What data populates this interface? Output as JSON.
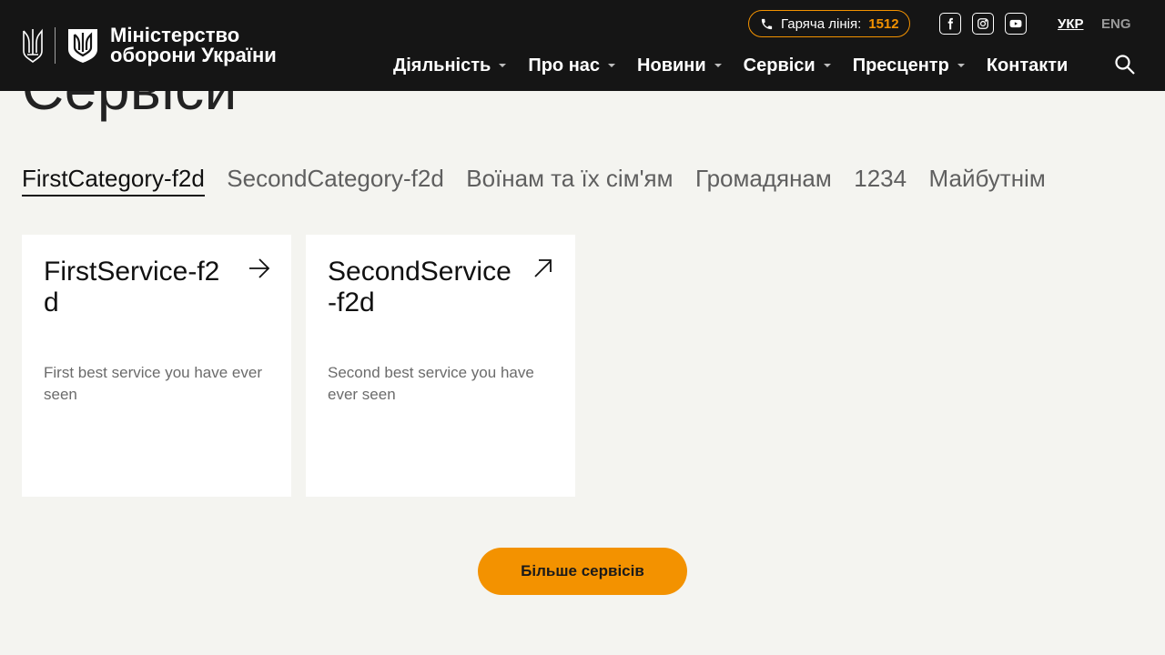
{
  "header": {
    "logo_line1": "Міністерство",
    "logo_line2": "оборони України",
    "hotline_label": "Гаряча лінія:",
    "hotline_number": "1512",
    "lang_active": "УКР",
    "lang_inactive": "ENG",
    "nav": [
      "Діяльність",
      "Про нас",
      "Новини",
      "Сервіси",
      "Пресцентр",
      "Контакти"
    ]
  },
  "page": {
    "title": "Сервіси"
  },
  "tabs": [
    "FirstCategory-f2d",
    "SecondCategory-f2d",
    "Воїнам та їх сім'ям",
    "Громадянам",
    "1234",
    "Майбутнім"
  ],
  "cards": [
    {
      "title": "FirstService-f2d",
      "description": "First best service you have ever seen",
      "icon": "arrow-right-icon"
    },
    {
      "title": "SecondService-f2d",
      "description": "Second best service you have ever seen",
      "icon": "arrow-up-right-icon"
    }
  ],
  "more_button": "Більше сервісів",
  "colors": {
    "header_bg": "#151515",
    "accent": "#f39200",
    "page_bg": "#f4f4f0"
  }
}
